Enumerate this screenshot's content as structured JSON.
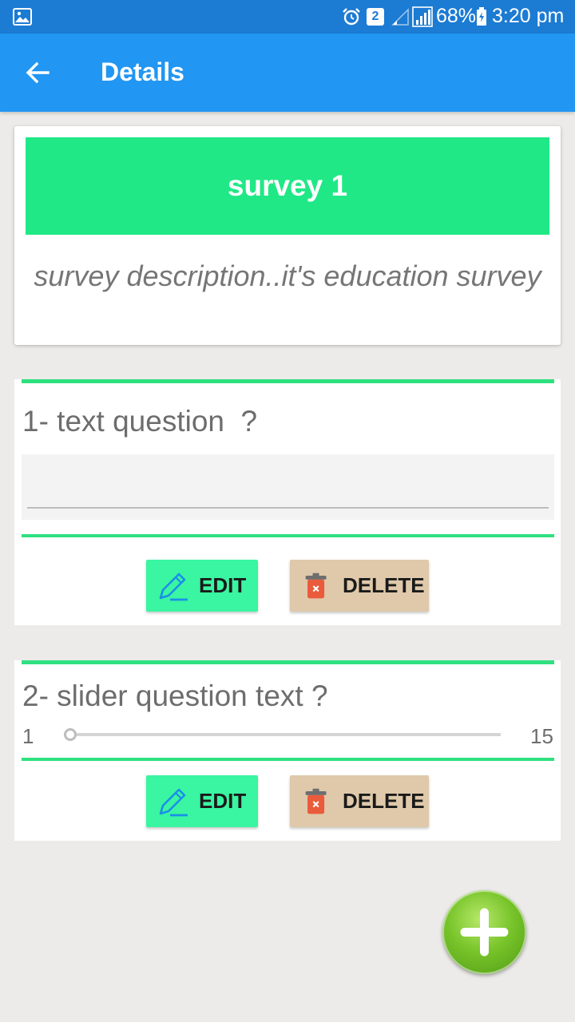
{
  "status_bar": {
    "notification_count": "2",
    "battery": "68%",
    "time": "3:20 pm",
    "icons": [
      "gallery-icon",
      "alarm-icon",
      "signal-empty-icon",
      "signal-icon",
      "battery-charging-icon"
    ]
  },
  "app_bar": {
    "title": "Details",
    "back_icon": "arrow-left-icon"
  },
  "survey": {
    "title": "survey 1",
    "description": "survey description..it's education survey",
    "accent_color": "#20e886"
  },
  "questions": [
    {
      "number_label": "1- text question  ?",
      "type": "text",
      "input_value": "",
      "edit_label": "EDIT",
      "delete_label": "DELETE"
    },
    {
      "number_label": "2- slider question text ?",
      "type": "slider",
      "slider_min": "1",
      "slider_max": "15",
      "slider_value": 1,
      "edit_label": "EDIT",
      "delete_label": "DELETE"
    }
  ],
  "colors": {
    "status_bar": "#1c7bd3",
    "app_bar": "#2196f3",
    "edit_button": "#3af5a1",
    "delete_button": "#dfc9aa",
    "fab": "#78c42a"
  },
  "fab": {
    "icon": "plus-icon"
  }
}
